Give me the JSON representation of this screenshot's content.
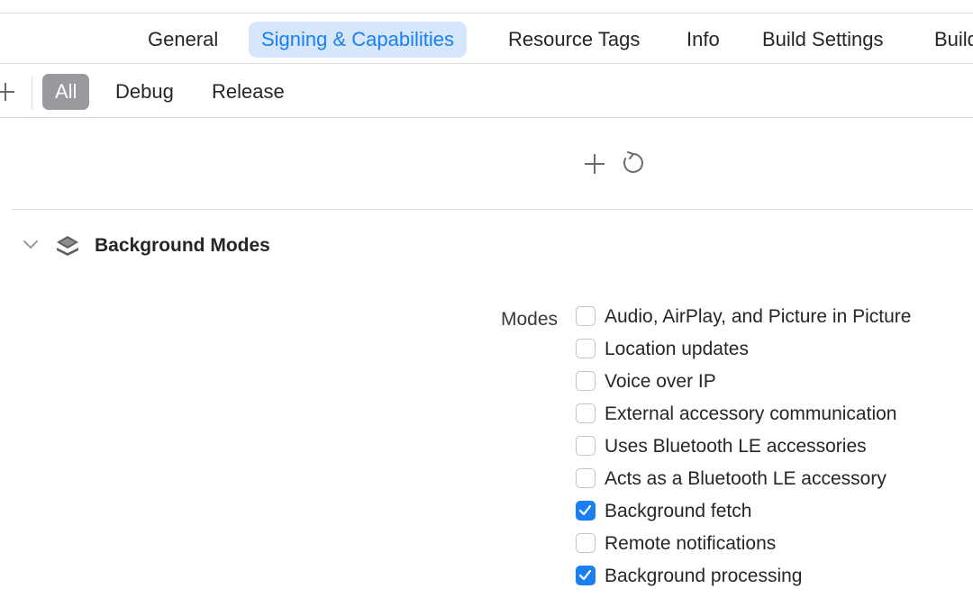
{
  "tabs": [
    {
      "label": "General",
      "active": false
    },
    {
      "label": "Signing & Capabilities",
      "active": true
    },
    {
      "label": "Resource Tags",
      "active": false
    },
    {
      "label": "Info",
      "active": false
    },
    {
      "label": "Build Settings",
      "active": false
    },
    {
      "label": "Build",
      "active": false
    }
  ],
  "filter": {
    "segments": [
      {
        "label": "All",
        "active": true
      },
      {
        "label": "Debug",
        "active": false
      },
      {
        "label": "Release",
        "active": false
      }
    ]
  },
  "section": {
    "title": "Background Modes",
    "modes_label": "Modes",
    "modes": [
      {
        "label": "Audio, AirPlay, and Picture in Picture",
        "checked": false
      },
      {
        "label": "Location updates",
        "checked": false
      },
      {
        "label": "Voice over IP",
        "checked": false
      },
      {
        "label": "External accessory communication",
        "checked": false
      },
      {
        "label": "Uses Bluetooth LE accessories",
        "checked": false
      },
      {
        "label": "Acts as a Bluetooth LE accessory",
        "checked": false
      },
      {
        "label": "Background fetch",
        "checked": true
      },
      {
        "label": "Remote notifications",
        "checked": false
      },
      {
        "label": "Background processing",
        "checked": true
      }
    ]
  },
  "colors": {
    "accent": "#1a7ff0",
    "active_tab_bg": "#d6e7fb",
    "active_segment_bg": "#9a9a9e"
  }
}
